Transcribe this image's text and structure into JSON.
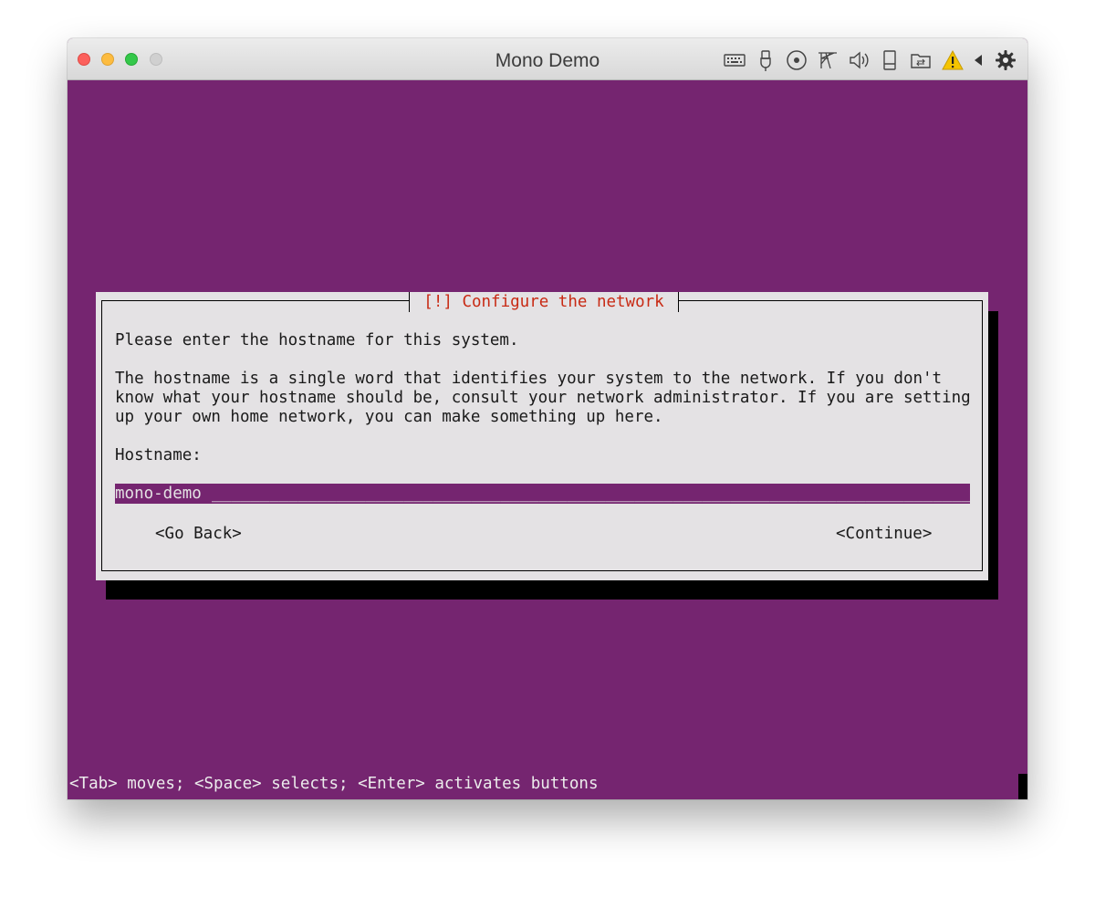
{
  "window": {
    "title": "Mono Demo"
  },
  "toolbar_icons": [
    "keyboard-icon",
    "usb-icon",
    "optical-disc-icon",
    "network-icon",
    "audio-icon",
    "storage-icon",
    "shared-folder-icon",
    "warning-icon",
    "back-arrow-icon",
    "settings-gear-icon"
  ],
  "dialog": {
    "title": "[!] Configure the network",
    "prompt": "Please enter the hostname for this system.",
    "description_lines": [
      "The hostname is a single word that identifies your system to the network. If you don't",
      "know what your hostname should be, consult your network administrator. If you are setting",
      "up your own home network, you can make something up here."
    ],
    "field_label": "Hostname:",
    "field_value": "mono-demo",
    "field_fill": "_________________________________________________________________________________________",
    "back_button": "<Go Back>",
    "continue_button": "<Continue>"
  },
  "status_bar": {
    "hint": "<Tab> moves; <Space> selects; <Enter> activates buttons"
  },
  "colors": {
    "terminal_background": "#752570",
    "dialog_background": "#e4e2e4",
    "dialog_title": "#c82a14",
    "warning_accent": "#f5c400"
  }
}
